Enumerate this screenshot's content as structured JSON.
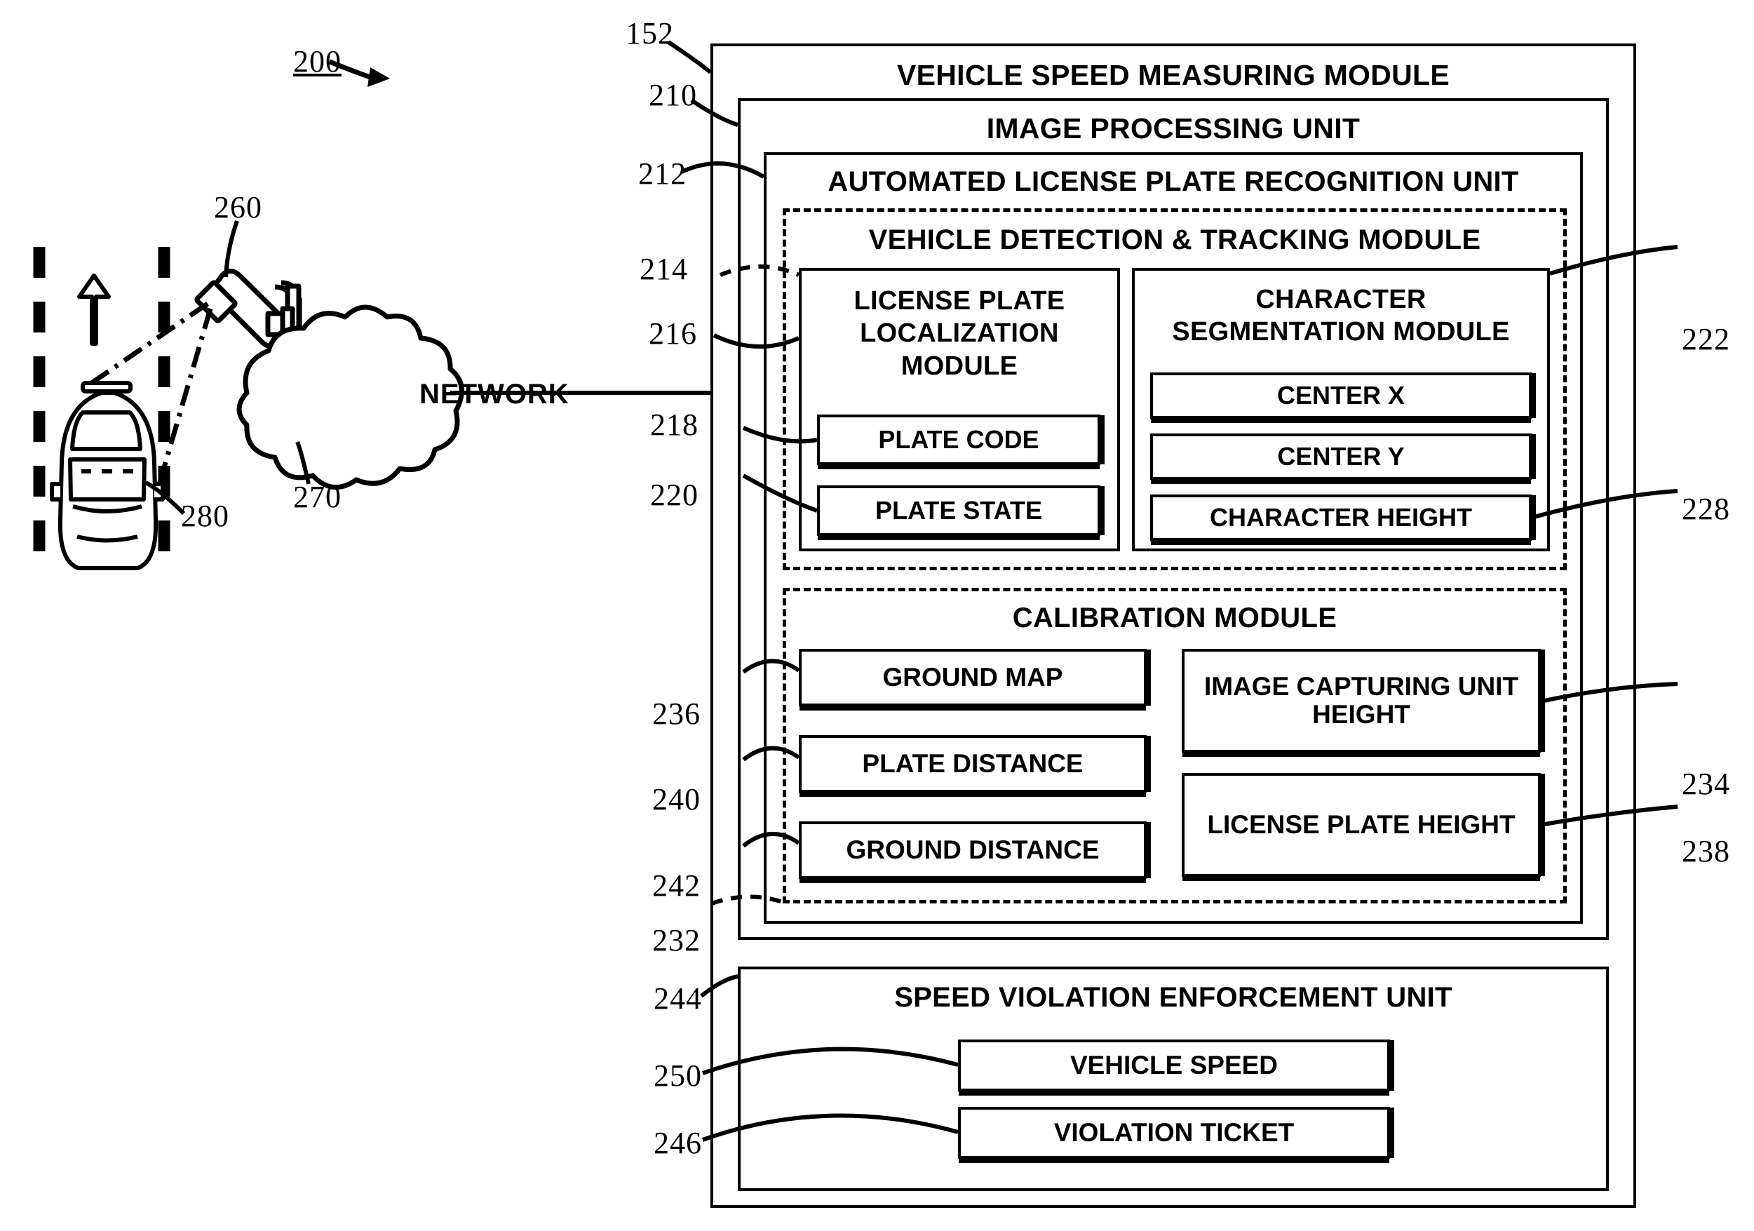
{
  "figure": {
    "figure_number": "200"
  },
  "left_scene": {
    "network_label": "NETWORK",
    "refs": {
      "camera": "260",
      "network": "270",
      "vehicle": "280"
    },
    "icons": {
      "camera": "surveillance-camera-icon",
      "vehicle": "car-top-view-icon",
      "cloud": "network-cloud-icon",
      "direction": "direction-arrow-icon",
      "lane": "lane-marking-dashed"
    }
  },
  "system": {
    "ref": "152",
    "title": "VEHICLE SPEED MEASURING MODULE",
    "image_processing_unit": {
      "ref": "210",
      "title": "IMAGE PROCESSING UNIT",
      "alpr_unit": {
        "ref": "212",
        "title": "AUTOMATED LICENSE PLATE RECOGNITION UNIT",
        "vehicle_detection_tracking": {
          "ref": "214",
          "title": "VEHICLE DETECTION & TRACKING MODULE",
          "license_plate_localization": {
            "ref": "216",
            "title": "LICENSE PLATE LOCALIZATION MODULE",
            "items": [
              {
                "ref": "218",
                "label": "PLATE CODE"
              },
              {
                "ref": "220",
                "label": "PLATE STATE"
              }
            ]
          },
          "character_segmentation": {
            "ref": "222",
            "title": "CHARACTER SEGMENTATION MODULE",
            "items": [
              {
                "ref": "",
                "label": "CENTER X"
              },
              {
                "ref": "",
                "label": "CENTER Y"
              },
              {
                "ref": "228",
                "label": "CHARACTER HEIGHT"
              }
            ]
          }
        },
        "calibration_module": {
          "ref": "232",
          "title": "CALIBRATION MODULE",
          "left_items": [
            {
              "ref": "236",
              "label": "GROUND MAP"
            },
            {
              "ref": "240",
              "label": "PLATE DISTANCE"
            },
            {
              "ref": "242",
              "label": "GROUND DISTANCE"
            }
          ],
          "right_items": [
            {
              "ref": "234",
              "label": "IMAGE CAPTURING UNIT HEIGHT"
            },
            {
              "ref": "238",
              "label": "LICENSE PLATE HEIGHT"
            }
          ]
        }
      }
    },
    "speed_violation_unit": {
      "ref": "244",
      "title": "SPEED VIOLATION ENFORCEMENT UNIT",
      "items": [
        {
          "ref": "250",
          "label": "VEHICLE SPEED"
        },
        {
          "ref": "246",
          "label": "VIOLATION TICKET"
        }
      ]
    }
  }
}
